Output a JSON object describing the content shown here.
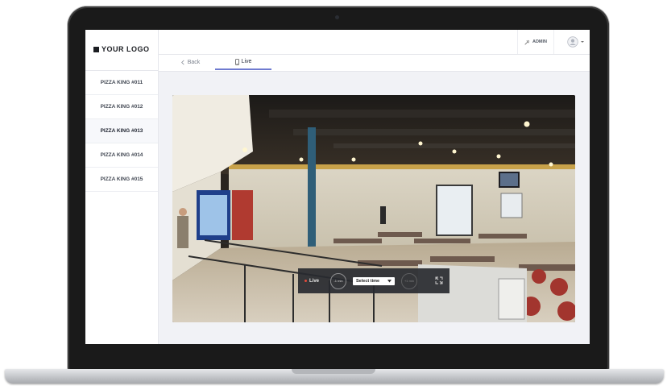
{
  "brand": {
    "logo_text": "YOUR LOGO"
  },
  "sidebar": {
    "items": [
      {
        "label": "PIZZA KING #011"
      },
      {
        "label": "PIZZA KING #012"
      },
      {
        "label": "PIZZA KING #013",
        "active": true
      },
      {
        "label": "PIZZA KING #014"
      },
      {
        "label": "PIZZA KING #015"
      }
    ]
  },
  "header": {
    "admin_label": "ADMIN",
    "admin_icon": "tools-icon",
    "avatar_icon": "user-avatar-icon"
  },
  "tabs": {
    "back_label": "Back",
    "live_label": "Live"
  },
  "player": {
    "status_label": "Live",
    "rewind_label": "-1 min",
    "select_label": "Select time",
    "forward_label": "+1 min",
    "expand_icon": "expand-icon"
  },
  "colors": {
    "accent": "#6f7bd0",
    "live_dot": "#e24a3b"
  }
}
